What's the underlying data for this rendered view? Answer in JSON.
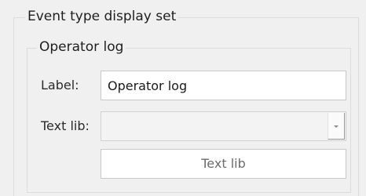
{
  "groups": {
    "outer_title": "Event type display set",
    "inner_title": "Operator log"
  },
  "form": {
    "label_caption": "Label:",
    "label_value": "Operator log",
    "textlib_caption": "Text lib:",
    "textlib_value": "",
    "textlib_button": "Text lib"
  },
  "colors": {
    "panel_background": "#f0f0f0",
    "border": "#dcdcdc",
    "button_text_disabled": "#6b6b6b"
  },
  "icons": {
    "combo_dropdown": "chevron-down-icon"
  }
}
